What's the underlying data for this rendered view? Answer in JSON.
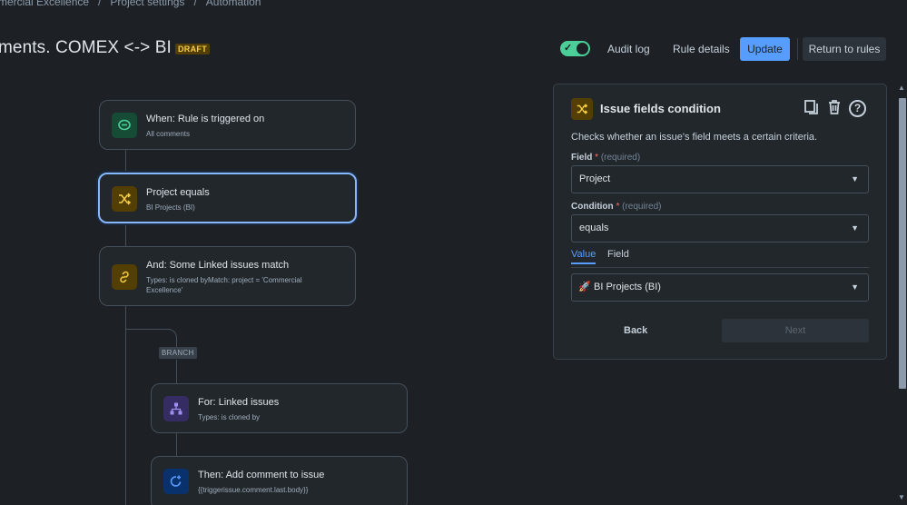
{
  "breadcrumb": {
    "items": [
      "mercial Excellence",
      "Project settings",
      "Automation"
    ],
    "separator": "/"
  },
  "header": {
    "title": "ments. COMEX <-> BI",
    "badge": "DRAFT",
    "toggle_on": true,
    "audit_log": "Audit log",
    "rule_details": "Rule details",
    "update": "Update",
    "return_to_rules": "Return to rules"
  },
  "flow": {
    "nodes": [
      {
        "title": "When: Rule is triggered on",
        "subtitle": "All comments",
        "icon": "comment-icon"
      },
      {
        "title": "Project equals",
        "subtitle": "BI Projects (BI)",
        "icon": "shuffle-icon"
      },
      {
        "title": "And: Some Linked issues match",
        "subtitle": "Types: is cloned byMatch: project = 'Commercial Excellence'",
        "icon": "link-icon"
      },
      {
        "title": "For: Linked issues",
        "subtitle": "Types: is cloned by",
        "icon": "hierarchy-icon"
      },
      {
        "title": "Then: Add comment to issue",
        "subtitle": "{{triggerissue.comment.last.body}}",
        "icon": "comment-add-icon"
      }
    ],
    "branch_label": "BRANCH"
  },
  "panel": {
    "title": "Issue fields condition",
    "description": "Checks whether an issue's field meets a certain criteria.",
    "field_label": "Field",
    "condition_label": "Condition",
    "required_mark": "*",
    "required_text": "(required)",
    "field_value": "Project",
    "condition_value": "equals",
    "tabs": [
      "Value",
      "Field"
    ],
    "active_tab": "Value",
    "value_selected": "BI Projects (BI)",
    "back": "Back",
    "next": "Next"
  },
  "colors": {
    "background": "#1d2125",
    "accent": "#579dff",
    "toggle": "#4bce97",
    "draft_badge": "#f5cd47"
  }
}
